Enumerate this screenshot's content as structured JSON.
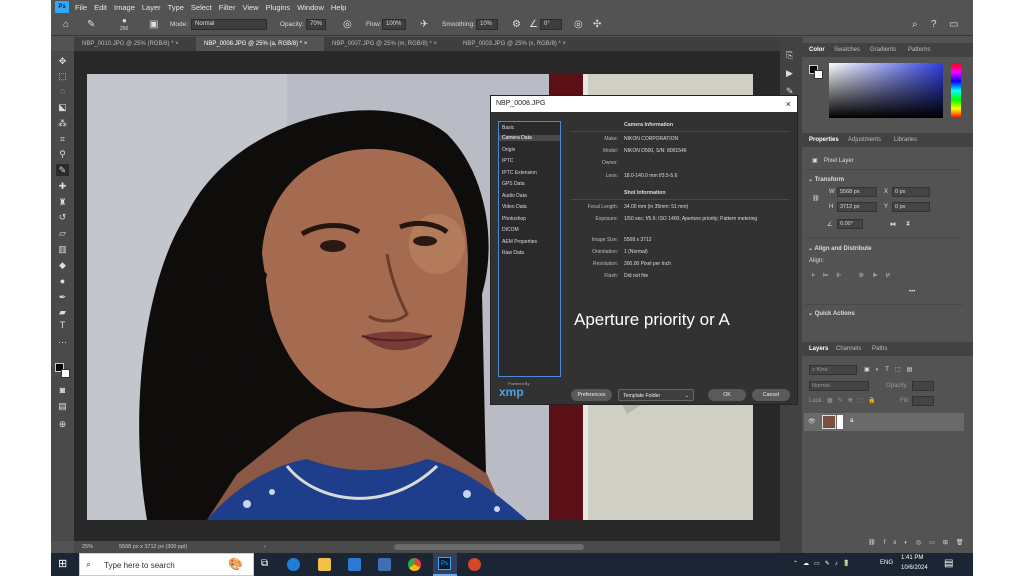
{
  "menubar": {
    "app_icon": "Ps",
    "items": [
      "File",
      "Edit",
      "Image",
      "Layer",
      "Type",
      "Select",
      "Filter",
      "View",
      "Plugins",
      "Window",
      "Help"
    ]
  },
  "options_bar": {
    "brush_size": "250",
    "mode_label": "Mode:",
    "mode_value": "Normal",
    "opacity_label": "Opacity:",
    "opacity_value": "70%",
    "flow_label": "Flow:",
    "flow_value": "100%",
    "smoothing_label": "Smoothing:",
    "smoothing_value": "10%",
    "angle_value": "0°"
  },
  "doc_tabs": [
    {
      "label": "NBP_0010.JPG @ 25% (RGB/8) *"
    },
    {
      "label": "NBP_0008.JPG @ 25% (a, RGB/8) *"
    },
    {
      "label": "NBP_0007.JPG @ 25% (m, RGB/8) *"
    },
    {
      "label": "NBP_0003.JPG @ 25% (x, RGB/8) *"
    }
  ],
  "status_bar": {
    "zoom": "25%",
    "doc_info": "5568 px x 3712 px (300 ppi)"
  },
  "dialog": {
    "title": "NBP_0008.JPG",
    "sidebar_items": [
      "Basic",
      "Camera Data",
      "Origin",
      "IPTC",
      "IPTC Extension",
      "GPS Data",
      "Audio Data",
      "Video Data",
      "Photoshop",
      "DICOM",
      "AEM Properties",
      "Raw Data"
    ],
    "camera_info_heading": "Camera Information",
    "camera_fields": [
      {
        "label": "Make:",
        "value": "NIKON CORPORATION"
      },
      {
        "label": "Model:",
        "value": "NIKON D500,   S/N: 8001546"
      },
      {
        "label": "Owner:",
        "value": ""
      },
      {
        "label": "Lens:",
        "value": "18.0-140.0 mm f/3.5-5.6"
      }
    ],
    "shot_info_heading": "Shot Information",
    "shot_fields": [
      {
        "label": "Focal Length:",
        "value": "34.00 mm   (in 35mm: 51 mm)"
      },
      {
        "label": "Exposure:",
        "value": "1/50 sec;  f/5.6;  ISO 1400;  Aperture priority;  Pattern metering"
      },
      {
        "label": "Image Size:",
        "value": "5568 x 3712"
      },
      {
        "label": "Orientation:",
        "value": "1 (Normal)"
      },
      {
        "label": "Resolution:",
        "value": "300.00 Pixel per Inch"
      },
      {
        "label": "Flash:",
        "value": "Did not fire"
      }
    ],
    "overlay_text": "Aperture priority or A",
    "powered_by": "Powered By",
    "xmp_logo": "xmp",
    "preferences_label": "Preferences",
    "template_folder_label": "Template Folder",
    "ok_label": "OK",
    "cancel_label": "Cancel"
  },
  "right_panel": {
    "color_tabs": [
      "Color",
      "Swatches",
      "Gradients",
      "Patterns"
    ],
    "props_tabs": [
      "Properties",
      "Adjustments",
      "Libraries"
    ],
    "pixel_layer_label": "Pixel Layer",
    "transform_heading": "Transform",
    "w_label": "W",
    "w_value": "5568 px",
    "h_label": "H",
    "h_value": "3712 px",
    "x_label": "X",
    "x_value": "0 px",
    "y_label": "Y",
    "y_value": "0 px",
    "angle_value": "0.00°",
    "align_heading": "Align and Distribute",
    "align_label": "Align:",
    "quick_actions_heading": "Quick Actions",
    "layers_tabs": [
      "Layers",
      "Channels",
      "Paths"
    ],
    "kind_label": "Kind",
    "blend_mode": "Normal",
    "opacity_label": "Opacity:",
    "lock_label": "Lock:",
    "fill_label": "Fill:",
    "layer_name": "a"
  },
  "taskbar": {
    "search_placeholder": "Type here to search",
    "language": "ENG",
    "time": "1:41 PM",
    "date": "10/6/2024"
  },
  "colors": {
    "ps_blue": "#31a8ff",
    "panel_gray": "#535353",
    "dialog_bg": "#323232",
    "taskbar_bg": "#1c2533"
  }
}
